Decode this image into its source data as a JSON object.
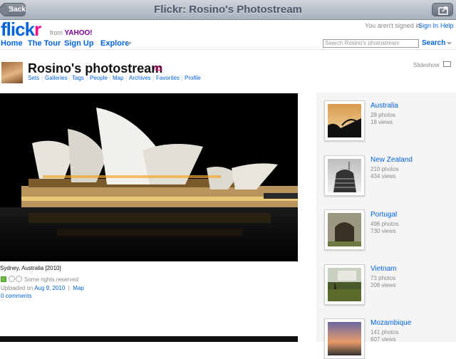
{
  "titlebar": {
    "title": "Flickr: Rosino's Photostream",
    "back_label": "Back"
  },
  "header": {
    "logo_part1": "flick",
    "logo_part2": "r",
    "from_label": "from",
    "yahoo_label": "YAHOO!",
    "nav": [
      {
        "label": "Home"
      },
      {
        "label": "The Tour"
      },
      {
        "label": "Sign Up"
      },
      {
        "label": "Explore"
      }
    ],
    "signed_out_text": "You aren't signed in",
    "signin_label": "Sign In",
    "help_label": "Help",
    "search_placeholder": "Search Rosino's photostream",
    "search_label": "Search"
  },
  "profile": {
    "title": "Rosino's photostream",
    "pro_badge": "pro",
    "subnav": [
      "Sets",
      "Galleries",
      "Tags",
      "People",
      "Map",
      "Archives",
      "Favorites",
      "Profile"
    ],
    "slideshow_label": "Slideshow"
  },
  "photo": {
    "caption": "Sydney, Australia [2010]",
    "license": "Some rights reserved",
    "uploaded_prefix": "Uploaded on",
    "uploaded_date": "Aug 9, 2010",
    "separator": "|",
    "map_label": "Map",
    "comments": "0 comments"
  },
  "sets": [
    {
      "name": "Australia",
      "photos": "28 photos",
      "views": "18 views",
      "thumb": "sunset"
    },
    {
      "name": "New Zealand",
      "photos": "210 photos",
      "views": "434 views",
      "thumb": "beehive"
    },
    {
      "name": "Portugal",
      "photos": "496 photos",
      "views": "730 views",
      "thumb": "stone"
    },
    {
      "name": "Vietnam",
      "photos": "73 photos",
      "views": "208 views",
      "thumb": "tree"
    },
    {
      "name": "Mozambique",
      "photos": "141 photos",
      "views": "607 views",
      "thumb": "dusk"
    }
  ],
  "colors": {
    "flickr_blue": "#0063dc",
    "flickr_pink": "#ff0084",
    "yahoo_purple": "#7b0099"
  }
}
